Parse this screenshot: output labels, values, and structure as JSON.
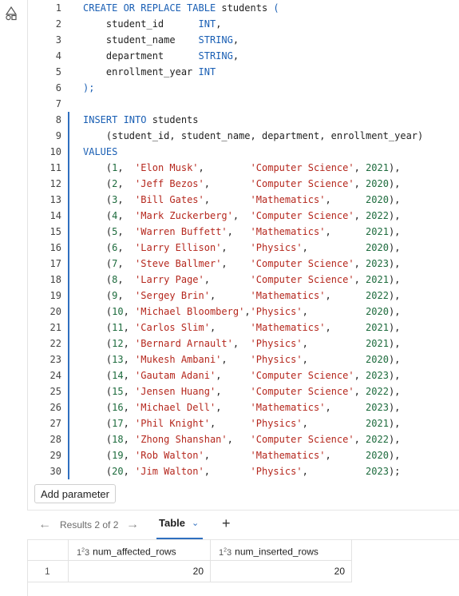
{
  "editor": {
    "lines": [
      {
        "n": "1",
        "tokens": [
          {
            "t": "CREATE OR REPLACE TABLE",
            "c": "kw"
          },
          {
            "t": " students ",
            "c": "pun"
          },
          {
            "t": "(",
            "c": "kw"
          }
        ]
      },
      {
        "n": "2",
        "tokens": [
          {
            "t": "    student_id      ",
            "c": "pun"
          },
          {
            "t": "INT",
            "c": "kw"
          },
          {
            "t": ",",
            "c": "pun"
          }
        ]
      },
      {
        "n": "3",
        "tokens": [
          {
            "t": "    student_name    ",
            "c": "pun"
          },
          {
            "t": "STRING",
            "c": "kw"
          },
          {
            "t": ",",
            "c": "pun"
          }
        ]
      },
      {
        "n": "4",
        "tokens": [
          {
            "t": "    department      ",
            "c": "pun"
          },
          {
            "t": "STRING",
            "c": "kw"
          },
          {
            "t": ",",
            "c": "pun"
          }
        ]
      },
      {
        "n": "5",
        "tokens": [
          {
            "t": "    enrollment_year ",
            "c": "pun"
          },
          {
            "t": "INT",
            "c": "kw"
          }
        ]
      },
      {
        "n": "6",
        "tokens": [
          {
            "t": ");",
            "c": "kw"
          }
        ]
      },
      {
        "n": "7",
        "tokens": []
      },
      {
        "n": "8",
        "tokens": [
          {
            "t": "INSERT INTO",
            "c": "kw"
          },
          {
            "t": " students",
            "c": "pun"
          }
        ]
      },
      {
        "n": "9",
        "tokens": [
          {
            "t": "    (student_id, student_name, department, enrollment_year)",
            "c": "pun"
          }
        ]
      },
      {
        "n": "10",
        "tokens": [
          {
            "t": "VALUES",
            "c": "kw"
          }
        ]
      },
      {
        "n": "11",
        "tokens": [
          {
            "t": "    (",
            "c": "pun"
          },
          {
            "t": "1",
            "c": "num"
          },
          {
            "t": ",  ",
            "c": "pun"
          },
          {
            "t": "'Elon Musk'",
            "c": "str"
          },
          {
            "t": ",        ",
            "c": "pun"
          },
          {
            "t": "'Computer Science'",
            "c": "str"
          },
          {
            "t": ", ",
            "c": "pun"
          },
          {
            "t": "2021",
            "c": "num"
          },
          {
            "t": "),",
            "c": "pun"
          }
        ]
      },
      {
        "n": "12",
        "tokens": [
          {
            "t": "    (",
            "c": "pun"
          },
          {
            "t": "2",
            "c": "num"
          },
          {
            "t": ",  ",
            "c": "pun"
          },
          {
            "t": "'Jeff Bezos'",
            "c": "str"
          },
          {
            "t": ",       ",
            "c": "pun"
          },
          {
            "t": "'Computer Science'",
            "c": "str"
          },
          {
            "t": ", ",
            "c": "pun"
          },
          {
            "t": "2020",
            "c": "num"
          },
          {
            "t": "),",
            "c": "pun"
          }
        ]
      },
      {
        "n": "13",
        "tokens": [
          {
            "t": "    (",
            "c": "pun"
          },
          {
            "t": "3",
            "c": "num"
          },
          {
            "t": ",  ",
            "c": "pun"
          },
          {
            "t": "'Bill Gates'",
            "c": "str"
          },
          {
            "t": ",       ",
            "c": "pun"
          },
          {
            "t": "'Mathematics'",
            "c": "str"
          },
          {
            "t": ",      ",
            "c": "pun"
          },
          {
            "t": "2020",
            "c": "num"
          },
          {
            "t": "),",
            "c": "pun"
          }
        ]
      },
      {
        "n": "14",
        "tokens": [
          {
            "t": "    (",
            "c": "pun"
          },
          {
            "t": "4",
            "c": "num"
          },
          {
            "t": ",  ",
            "c": "pun"
          },
          {
            "t": "'Mark Zuckerberg'",
            "c": "str"
          },
          {
            "t": ",  ",
            "c": "pun"
          },
          {
            "t": "'Computer Science'",
            "c": "str"
          },
          {
            "t": ", ",
            "c": "pun"
          },
          {
            "t": "2022",
            "c": "num"
          },
          {
            "t": "),",
            "c": "pun"
          }
        ]
      },
      {
        "n": "15",
        "tokens": [
          {
            "t": "    (",
            "c": "pun"
          },
          {
            "t": "5",
            "c": "num"
          },
          {
            "t": ",  ",
            "c": "pun"
          },
          {
            "t": "'Warren Buffett'",
            "c": "str"
          },
          {
            "t": ",   ",
            "c": "pun"
          },
          {
            "t": "'Mathematics'",
            "c": "str"
          },
          {
            "t": ",      ",
            "c": "pun"
          },
          {
            "t": "2021",
            "c": "num"
          },
          {
            "t": "),",
            "c": "pun"
          }
        ]
      },
      {
        "n": "16",
        "tokens": [
          {
            "t": "    (",
            "c": "pun"
          },
          {
            "t": "6",
            "c": "num"
          },
          {
            "t": ",  ",
            "c": "pun"
          },
          {
            "t": "'Larry Ellison'",
            "c": "str"
          },
          {
            "t": ",    ",
            "c": "pun"
          },
          {
            "t": "'Physics'",
            "c": "str"
          },
          {
            "t": ",          ",
            "c": "pun"
          },
          {
            "t": "2020",
            "c": "num"
          },
          {
            "t": "),",
            "c": "pun"
          }
        ]
      },
      {
        "n": "17",
        "tokens": [
          {
            "t": "    (",
            "c": "pun"
          },
          {
            "t": "7",
            "c": "num"
          },
          {
            "t": ",  ",
            "c": "pun"
          },
          {
            "t": "'Steve Ballmer'",
            "c": "str"
          },
          {
            "t": ",    ",
            "c": "pun"
          },
          {
            "t": "'Computer Science'",
            "c": "str"
          },
          {
            "t": ", ",
            "c": "pun"
          },
          {
            "t": "2023",
            "c": "num"
          },
          {
            "t": "),",
            "c": "pun"
          }
        ]
      },
      {
        "n": "18",
        "tokens": [
          {
            "t": "    (",
            "c": "pun"
          },
          {
            "t": "8",
            "c": "num"
          },
          {
            "t": ",  ",
            "c": "pun"
          },
          {
            "t": "'Larry Page'",
            "c": "str"
          },
          {
            "t": ",       ",
            "c": "pun"
          },
          {
            "t": "'Computer Science'",
            "c": "str"
          },
          {
            "t": ", ",
            "c": "pun"
          },
          {
            "t": "2021",
            "c": "num"
          },
          {
            "t": "),",
            "c": "pun"
          }
        ]
      },
      {
        "n": "19",
        "tokens": [
          {
            "t": "    (",
            "c": "pun"
          },
          {
            "t": "9",
            "c": "num"
          },
          {
            "t": ",  ",
            "c": "pun"
          },
          {
            "t": "'Sergey Brin'",
            "c": "str"
          },
          {
            "t": ",      ",
            "c": "pun"
          },
          {
            "t": "'Mathematics'",
            "c": "str"
          },
          {
            "t": ",      ",
            "c": "pun"
          },
          {
            "t": "2022",
            "c": "num"
          },
          {
            "t": "),",
            "c": "pun"
          }
        ]
      },
      {
        "n": "20",
        "tokens": [
          {
            "t": "    (",
            "c": "pun"
          },
          {
            "t": "10",
            "c": "num"
          },
          {
            "t": ", ",
            "c": "pun"
          },
          {
            "t": "'Michael Bloomberg'",
            "c": "str"
          },
          {
            "t": ",",
            "c": "pun"
          },
          {
            "t": "'Physics'",
            "c": "str"
          },
          {
            "t": ",          ",
            "c": "pun"
          },
          {
            "t": "2020",
            "c": "num"
          },
          {
            "t": "),",
            "c": "pun"
          }
        ]
      },
      {
        "n": "21",
        "tokens": [
          {
            "t": "    (",
            "c": "pun"
          },
          {
            "t": "11",
            "c": "num"
          },
          {
            "t": ", ",
            "c": "pun"
          },
          {
            "t": "'Carlos Slim'",
            "c": "str"
          },
          {
            "t": ",      ",
            "c": "pun"
          },
          {
            "t": "'Mathematics'",
            "c": "str"
          },
          {
            "t": ",      ",
            "c": "pun"
          },
          {
            "t": "2021",
            "c": "num"
          },
          {
            "t": "),",
            "c": "pun"
          }
        ]
      },
      {
        "n": "22",
        "tokens": [
          {
            "t": "    (",
            "c": "pun"
          },
          {
            "t": "12",
            "c": "num"
          },
          {
            "t": ", ",
            "c": "pun"
          },
          {
            "t": "'Bernard Arnault'",
            "c": "str"
          },
          {
            "t": ",  ",
            "c": "pun"
          },
          {
            "t": "'Physics'",
            "c": "str"
          },
          {
            "t": ",          ",
            "c": "pun"
          },
          {
            "t": "2021",
            "c": "num"
          },
          {
            "t": "),",
            "c": "pun"
          }
        ]
      },
      {
        "n": "23",
        "tokens": [
          {
            "t": "    (",
            "c": "pun"
          },
          {
            "t": "13",
            "c": "num"
          },
          {
            "t": ", ",
            "c": "pun"
          },
          {
            "t": "'Mukesh Ambani'",
            "c": "str"
          },
          {
            "t": ",    ",
            "c": "pun"
          },
          {
            "t": "'Physics'",
            "c": "str"
          },
          {
            "t": ",          ",
            "c": "pun"
          },
          {
            "t": "2020",
            "c": "num"
          },
          {
            "t": "),",
            "c": "pun"
          }
        ]
      },
      {
        "n": "24",
        "tokens": [
          {
            "t": "    (",
            "c": "pun"
          },
          {
            "t": "14",
            "c": "num"
          },
          {
            "t": ", ",
            "c": "pun"
          },
          {
            "t": "'Gautam Adani'",
            "c": "str"
          },
          {
            "t": ",     ",
            "c": "pun"
          },
          {
            "t": "'Computer Science'",
            "c": "str"
          },
          {
            "t": ", ",
            "c": "pun"
          },
          {
            "t": "2023",
            "c": "num"
          },
          {
            "t": "),",
            "c": "pun"
          }
        ]
      },
      {
        "n": "25",
        "tokens": [
          {
            "t": "    (",
            "c": "pun"
          },
          {
            "t": "15",
            "c": "num"
          },
          {
            "t": ", ",
            "c": "pun"
          },
          {
            "t": "'Jensen Huang'",
            "c": "str"
          },
          {
            "t": ",     ",
            "c": "pun"
          },
          {
            "t": "'Computer Science'",
            "c": "str"
          },
          {
            "t": ", ",
            "c": "pun"
          },
          {
            "t": "2022",
            "c": "num"
          },
          {
            "t": "),",
            "c": "pun"
          }
        ]
      },
      {
        "n": "26",
        "tokens": [
          {
            "t": "    (",
            "c": "pun"
          },
          {
            "t": "16",
            "c": "num"
          },
          {
            "t": ", ",
            "c": "pun"
          },
          {
            "t": "'Michael Dell'",
            "c": "str"
          },
          {
            "t": ",     ",
            "c": "pun"
          },
          {
            "t": "'Mathematics'",
            "c": "str"
          },
          {
            "t": ",      ",
            "c": "pun"
          },
          {
            "t": "2023",
            "c": "num"
          },
          {
            "t": "),",
            "c": "pun"
          }
        ]
      },
      {
        "n": "27",
        "tokens": [
          {
            "t": "    (",
            "c": "pun"
          },
          {
            "t": "17",
            "c": "num"
          },
          {
            "t": ", ",
            "c": "pun"
          },
          {
            "t": "'Phil Knight'",
            "c": "str"
          },
          {
            "t": ",      ",
            "c": "pun"
          },
          {
            "t": "'Physics'",
            "c": "str"
          },
          {
            "t": ",          ",
            "c": "pun"
          },
          {
            "t": "2021",
            "c": "num"
          },
          {
            "t": "),",
            "c": "pun"
          }
        ]
      },
      {
        "n": "28",
        "tokens": [
          {
            "t": "    (",
            "c": "pun"
          },
          {
            "t": "18",
            "c": "num"
          },
          {
            "t": ", ",
            "c": "pun"
          },
          {
            "t": "'Zhong Shanshan'",
            "c": "str"
          },
          {
            "t": ",   ",
            "c": "pun"
          },
          {
            "t": "'Computer Science'",
            "c": "str"
          },
          {
            "t": ", ",
            "c": "pun"
          },
          {
            "t": "2022",
            "c": "num"
          },
          {
            "t": "),",
            "c": "pun"
          }
        ]
      },
      {
        "n": "29",
        "tokens": [
          {
            "t": "    (",
            "c": "pun"
          },
          {
            "t": "19",
            "c": "num"
          },
          {
            "t": ", ",
            "c": "pun"
          },
          {
            "t": "'Rob Walton'",
            "c": "str"
          },
          {
            "t": ",       ",
            "c": "pun"
          },
          {
            "t": "'Mathematics'",
            "c": "str"
          },
          {
            "t": ",      ",
            "c": "pun"
          },
          {
            "t": "2020",
            "c": "num"
          },
          {
            "t": "),",
            "c": "pun"
          }
        ]
      },
      {
        "n": "30",
        "tokens": [
          {
            "t": "    (",
            "c": "pun"
          },
          {
            "t": "20",
            "c": "num"
          },
          {
            "t": ", ",
            "c": "pun"
          },
          {
            "t": "'Jim Walton'",
            "c": "str"
          },
          {
            "t": ",       ",
            "c": "pun"
          },
          {
            "t": "'Physics'",
            "c": "str"
          },
          {
            "t": ",          ",
            "c": "pun"
          },
          {
            "t": "2023",
            "c": "num"
          },
          {
            "t": ");",
            "c": "pun"
          }
        ]
      }
    ]
  },
  "toolbar": {
    "add_parameter_label": "Add parameter"
  },
  "results": {
    "pager_label": "Results 2 of 2",
    "active_tab_label": "Table",
    "prev_icon": "arrow-left-icon",
    "next_icon": "arrow-right-icon",
    "add_tab_icon": "plus-icon",
    "table": {
      "columns": [
        {
          "type_icon": "1²₃",
          "label": "num_affected_rows"
        },
        {
          "type_icon": "1²₃",
          "label": "num_inserted_rows"
        }
      ],
      "rows": [
        {
          "index": "1",
          "cells": [
            "20",
            "20"
          ]
        }
      ]
    }
  },
  "colors": {
    "accent": "#2f6fbf",
    "keyword": "#1a5fb4",
    "string": "#b5271d",
    "number": "#1d6b3d"
  }
}
